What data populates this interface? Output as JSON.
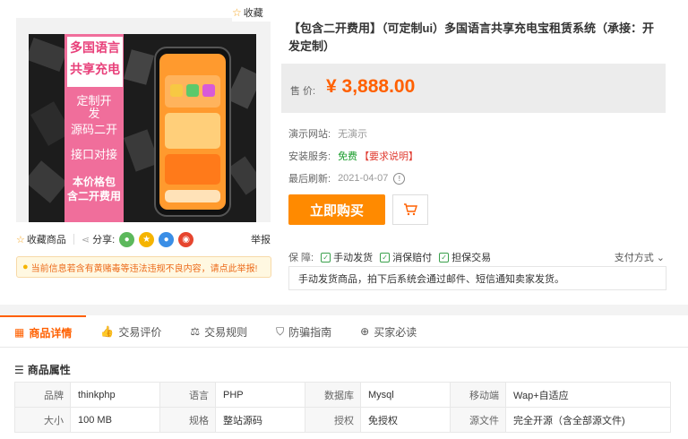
{
  "product": {
    "title": "【包含二开费用】（可定制ui）多国语言共享充电宝租赁系统（承接：开发定制）",
    "price_label": "售 价:",
    "price": "¥ 3,888.00"
  },
  "gallery": {
    "collect_top": "收藏",
    "banner_title_1": "多国语言",
    "banner_title_2": "共享充电",
    "banner_lines": [
      "定制开",
      "发",
      "源码二开",
      "接口对接"
    ],
    "banner_bold_1": "本价格包",
    "banner_bold_2": "含二开费用"
  },
  "share": {
    "collect": "收藏商品",
    "share": "分享:",
    "report": "举报"
  },
  "warning": "当前信息若含有黄赌毒等违法违规不良内容，请点此举报!",
  "info": {
    "demo_label": "演示网站:",
    "demo_value": "无演示",
    "install_label": "安装服务:",
    "install_value": "免费",
    "install_req": "【要求说明】",
    "refresh_label": "最后刷新:",
    "refresh_value": "2021-04-07"
  },
  "buttons": {
    "buy": "立即购买"
  },
  "guarantee": {
    "label": "保 障:",
    "items": [
      "手动发货",
      "消保赔付",
      "担保交易"
    ],
    "pay_method": "支付方式"
  },
  "delivery_note": "手动发货商品，拍下后系统会通过邮件、短信通知卖家发货。",
  "tabs": [
    "商品详情",
    "交易评价",
    "交易规则",
    "防骗指南",
    "买家必读"
  ],
  "attributes": {
    "heading": "商品属性",
    "rows": [
      [
        [
          "品牌",
          "thinkphp"
        ],
        [
          "语言",
          "PHP"
        ],
        [
          "数据库",
          "Mysql"
        ],
        [
          "移动端",
          "Wap+自适应"
        ]
      ],
      [
        [
          "大小",
          "100 MB"
        ],
        [
          "规格",
          "整站源码"
        ],
        [
          "授权",
          "免授权"
        ],
        [
          "源文件",
          "完全开源（含全部源文件)"
        ]
      ]
    ]
  },
  "colors": {
    "accent": "#ff6000",
    "buy_button": "#ff8a00",
    "banner_pink": "#f06e9b",
    "free_green": "#1a9d2c"
  }
}
